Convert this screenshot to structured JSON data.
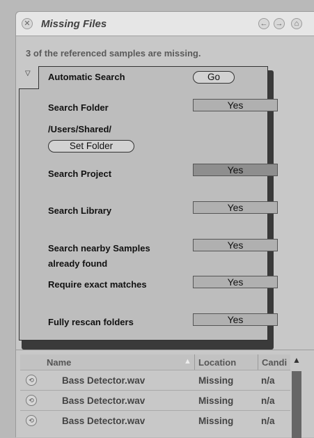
{
  "window": {
    "title": "Missing Files",
    "close_icon": "close-icon",
    "nav_icons": [
      "back-arrow-icon",
      "forward-icon",
      "home-icon"
    ]
  },
  "status_text": "3 of the referenced samples are missing.",
  "auto_search": {
    "header_label": "Automatic Search",
    "go_label": "Go",
    "search_folder": {
      "label": "Search Folder",
      "value": "Yes"
    },
    "folder_path": "/Users/Shared/",
    "set_folder_label": "Set Folder",
    "search_project": {
      "label": "Search Project",
      "value": "Yes"
    },
    "search_library": {
      "label": "Search Library",
      "value": "Yes"
    },
    "search_nearby": {
      "label_line1": "Search nearby Samples",
      "label_line2": "already found",
      "value": "Yes"
    },
    "exact_matches": {
      "label": "Require exact matches",
      "value": "Yes"
    },
    "rescan": {
      "label": "Fully rescan folders",
      "value": "Yes"
    }
  },
  "table": {
    "columns": [
      "Name",
      "Location",
      "Candi"
    ],
    "rows": [
      {
        "name": "Bass Detector.wav",
        "location": "Missing",
        "candidates": "n/a"
      },
      {
        "name": "Bass Detector.wav",
        "location": "Missing",
        "candidates": "n/a"
      },
      {
        "name": "Bass Detector.wav",
        "location": "Missing",
        "candidates": "n/a"
      }
    ]
  },
  "colors": {
    "panel_bg": "#c8c8c8",
    "box_bg": "#bdbdbd",
    "active_toggle": "#8e8e8e"
  }
}
